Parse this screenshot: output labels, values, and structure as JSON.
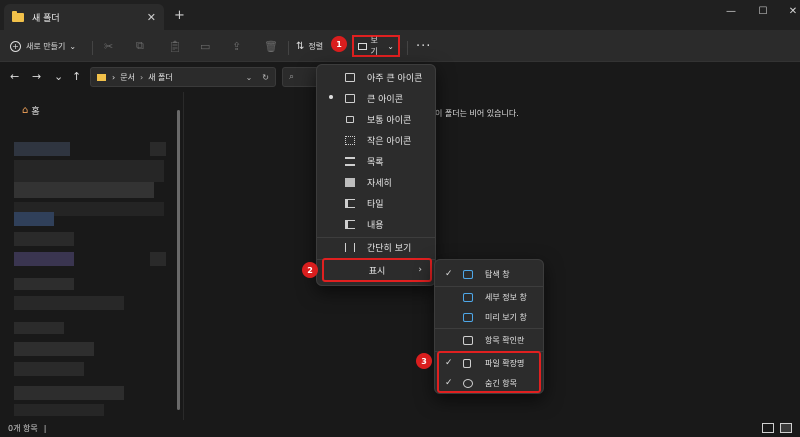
{
  "window": {
    "tab_title": "새 폴더",
    "tab_close": "✕",
    "new_tab": "+",
    "controls": {
      "minimize": "—",
      "maximize": "☐",
      "close": "✕"
    }
  },
  "command_bar": {
    "new_label": "새로 만들기",
    "new_chevron": "⌄",
    "sort_label": "정렬",
    "view_label": "보기",
    "view_chevron": "⌄",
    "more_label": "···",
    "badge_view": "1"
  },
  "address": {
    "back": "←",
    "forward": "→",
    "recent": "⌄",
    "up": "↑",
    "path": [
      "문서",
      "새 폴더"
    ],
    "chevron": "›",
    "dropdown": "⌄",
    "refresh": "↻",
    "search_icon": "⌕"
  },
  "sidebar": {
    "home_label": "홈"
  },
  "content": {
    "empty_message": "이 폴더는 비어 있습니다."
  },
  "view_menu": {
    "items": [
      {
        "label": "아주 큰 아이콘",
        "icon": "extra-large-icons-icon",
        "selected": false
      },
      {
        "label": "큰 아이콘",
        "icon": "large-icons-icon",
        "selected": true
      },
      {
        "label": "보통 아이콘",
        "icon": "medium-icons-icon",
        "selected": false
      },
      {
        "label": "작은 아이콘",
        "icon": "small-icons-icon",
        "selected": false
      },
      {
        "label": "목록",
        "icon": "list-icon",
        "selected": false
      },
      {
        "label": "자세히",
        "icon": "details-icon",
        "selected": false
      },
      {
        "label": "타일",
        "icon": "tiles-icon",
        "selected": false
      },
      {
        "label": "내용",
        "icon": "content-icon",
        "selected": false
      }
    ],
    "compact_label": "간단히 보기",
    "show_label": "표시",
    "show_arrow": "›",
    "badge_show": "2"
  },
  "show_submenu": {
    "items": [
      {
        "label": "탐색 창",
        "checked": true
      },
      {
        "label": "세부 정보 창",
        "checked": false
      },
      {
        "label": "미리 보기 창",
        "checked": false
      },
      {
        "label": "항목 확인란",
        "checked": false
      },
      {
        "label": "파일 확장명",
        "checked": true
      },
      {
        "label": "숨긴 항목",
        "checked": true
      }
    ],
    "check_mark": "✓",
    "badge": "3"
  },
  "status": {
    "item_count": "0개 항목",
    "cursor": "|"
  },
  "colors": {
    "accent_red": "#e02020",
    "badge_red": "#d91e1e",
    "folder_yellow": "#f2c14a",
    "pane_blue": "#4ea7e8"
  }
}
